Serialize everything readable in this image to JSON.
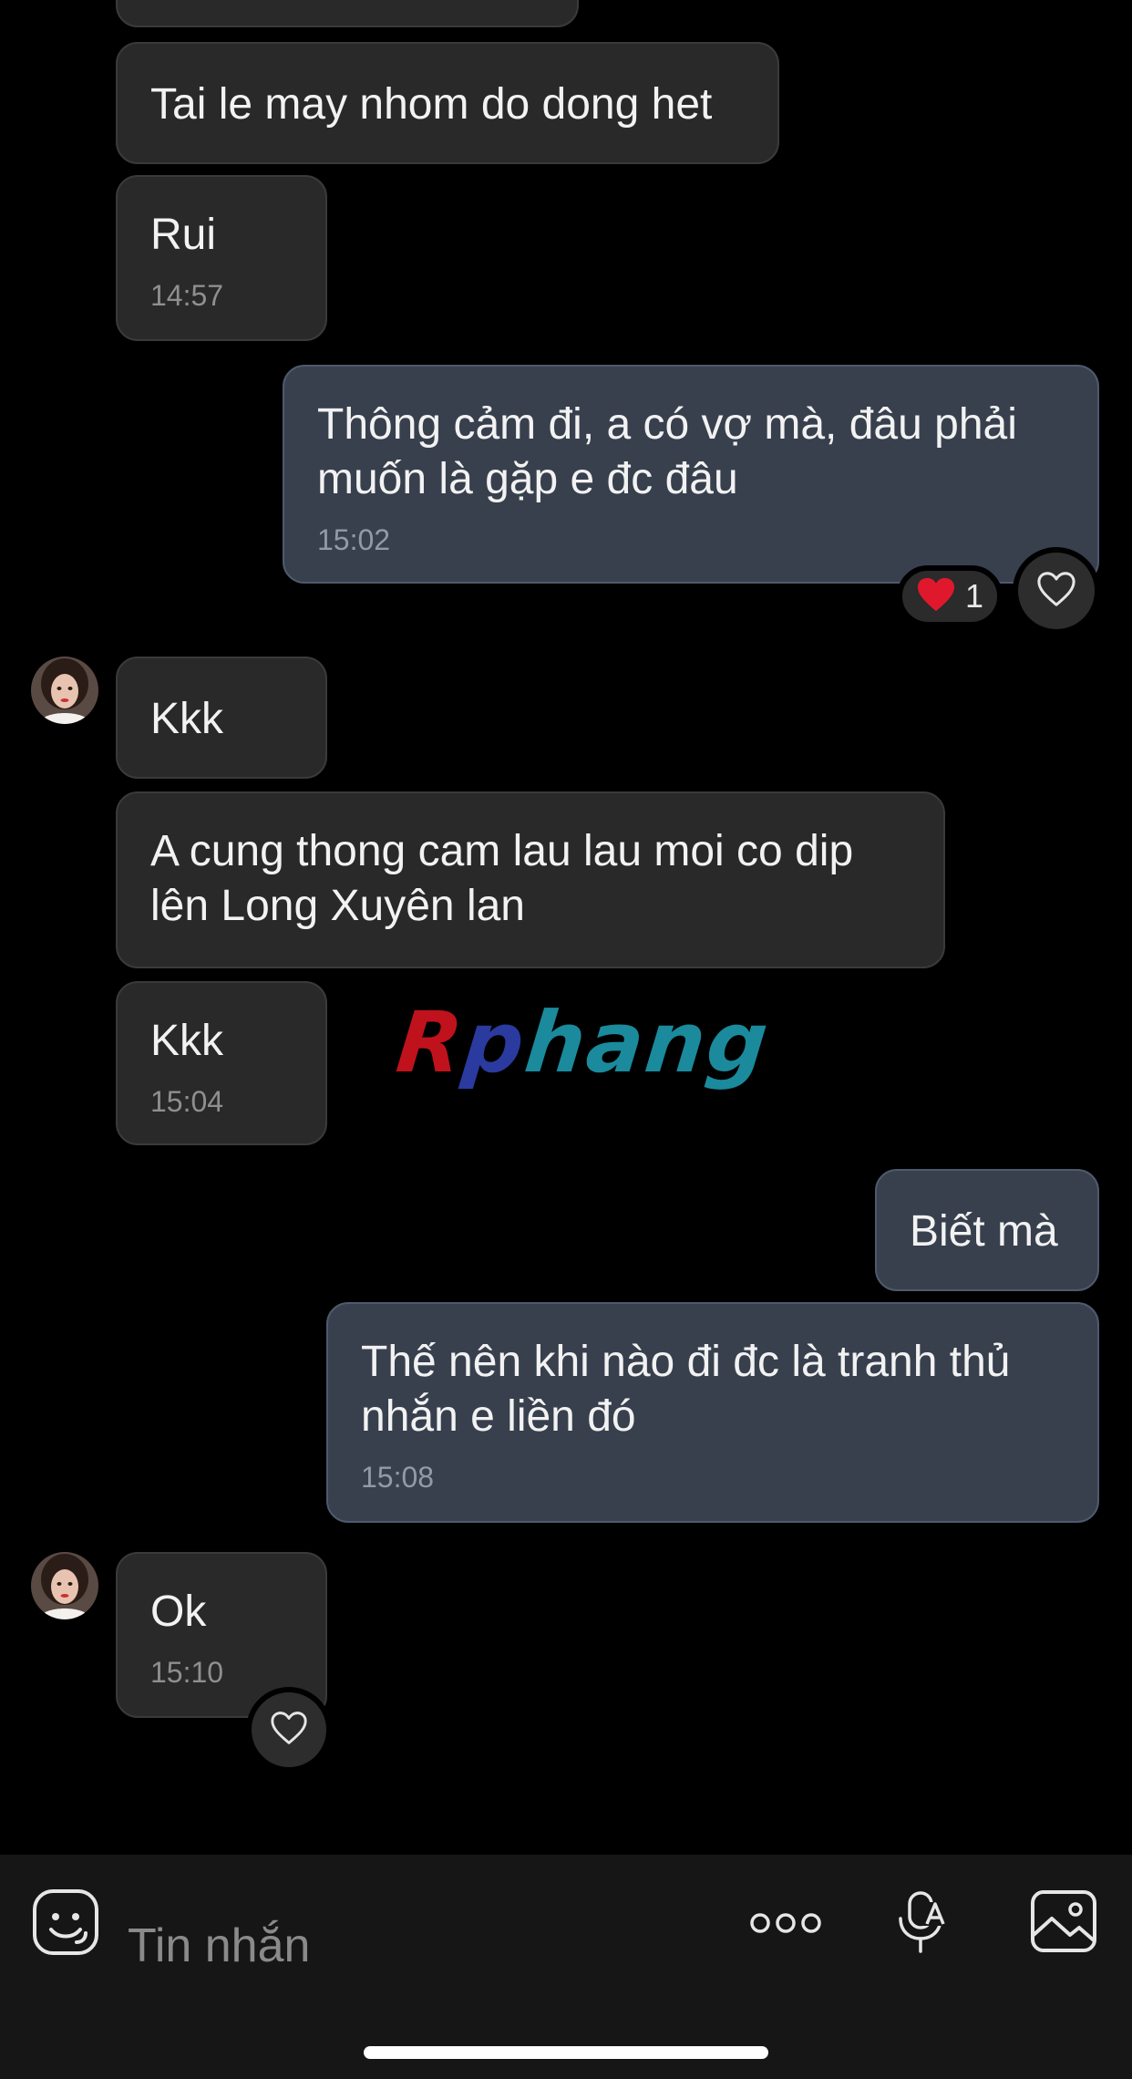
{
  "conversation": {
    "messages": [
      {
        "id": "m1",
        "direction": "incoming",
        "text": "Tai le may nhom do dong het",
        "time": ""
      },
      {
        "id": "m2",
        "direction": "incoming",
        "text": "Rui",
        "time": "14:57"
      },
      {
        "id": "m3",
        "direction": "outgoing",
        "text": "Thông cảm đi, a có vợ mà, đâu phải\nmuốn là gặp e đc đâu",
        "time": "15:02",
        "reaction": {
          "emoji": "❤️",
          "count": "1"
        }
      },
      {
        "id": "m4",
        "direction": "incoming",
        "text": "Kkk",
        "time": ""
      },
      {
        "id": "m5",
        "direction": "incoming",
        "text": "A cung thong cam lau lau moi co dip\nlên Long Xuyên lan",
        "time": ""
      },
      {
        "id": "m6",
        "direction": "incoming",
        "text": "Kkk",
        "time": "15:04"
      },
      {
        "id": "m7",
        "direction": "outgoing",
        "text": "Biết mà",
        "time": ""
      },
      {
        "id": "m8",
        "direction": "outgoing",
        "text": "Thế nên khi nào đi đc là tranh thủ\nnhắn e liền đó",
        "time": "15:08"
      },
      {
        "id": "m9",
        "direction": "incoming",
        "text": "Ok",
        "time": "15:10"
      }
    ]
  },
  "watermark": {
    "r": "R",
    "p": "p",
    "rest": "hang"
  },
  "composer": {
    "placeholder": "Tin nhắn"
  },
  "icons": {
    "sticker": "sticker-face-icon",
    "more": "more-dots-icon",
    "voice": "voice-to-text-icon",
    "image": "image-gallery-icon",
    "like": "heart-outline-icon"
  },
  "colors": {
    "background": "#000000",
    "incoming_bubble": "#292929",
    "outgoing_bubble": "#38404e",
    "composer_bg": "#161616",
    "timestamp": "#8f8f8f"
  }
}
